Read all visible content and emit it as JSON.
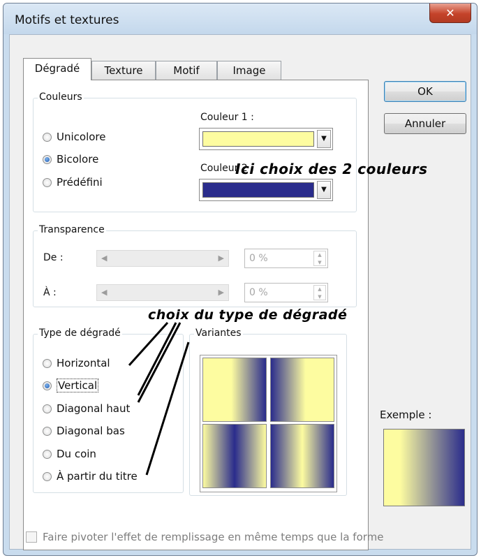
{
  "window": {
    "title": "Motifs et textures",
    "close_glyph": "✕"
  },
  "tabs": [
    {
      "label": "Dégradé"
    },
    {
      "label": "Texture"
    },
    {
      "label": "Motif"
    },
    {
      "label": "Image"
    }
  ],
  "couleurs": {
    "legend": "Couleurs",
    "radios": [
      {
        "label": "Unicolore",
        "checked": false
      },
      {
        "label": "Bicolore",
        "checked": true
      },
      {
        "label": "Prédéfini",
        "checked": false
      }
    ],
    "couleur1_label": "Couleur 1 :",
    "couleur1_value": "#fdfca0",
    "couleur2_label": "Couleur 2 :",
    "couleur2_value": "#2a2c8c"
  },
  "transparence": {
    "legend": "Transparence",
    "de_label": "De :",
    "de_value": "0 %",
    "a_label": "À :",
    "a_value": "0 %"
  },
  "type_degrade": {
    "legend": "Type de dégradé",
    "radios": [
      {
        "label": "Horizontal",
        "checked": false
      },
      {
        "label": "Vertical",
        "checked": true
      },
      {
        "label": "Diagonal haut",
        "checked": false
      },
      {
        "label": "Diagonal bas",
        "checked": false
      },
      {
        "label": "Du coin",
        "checked": false
      },
      {
        "label": "À partir du titre",
        "checked": false
      }
    ]
  },
  "variantes": {
    "legend": "Variantes"
  },
  "buttons": {
    "ok": "OK",
    "annuler": "Annuler"
  },
  "example": {
    "label": "Exemple :"
  },
  "rotate_checkbox": {
    "label": "Faire pivoter l'effet de remplissage en même temps que la forme",
    "checked": false
  },
  "annotations": {
    "colors": "Ici choix des 2 couleurs",
    "gradient_type": "choix du type de dégradé"
  },
  "colors": {
    "yellow": "#fdfca0",
    "navy": "#2a2c8c",
    "accent_blue": "#3c7fb1"
  }
}
